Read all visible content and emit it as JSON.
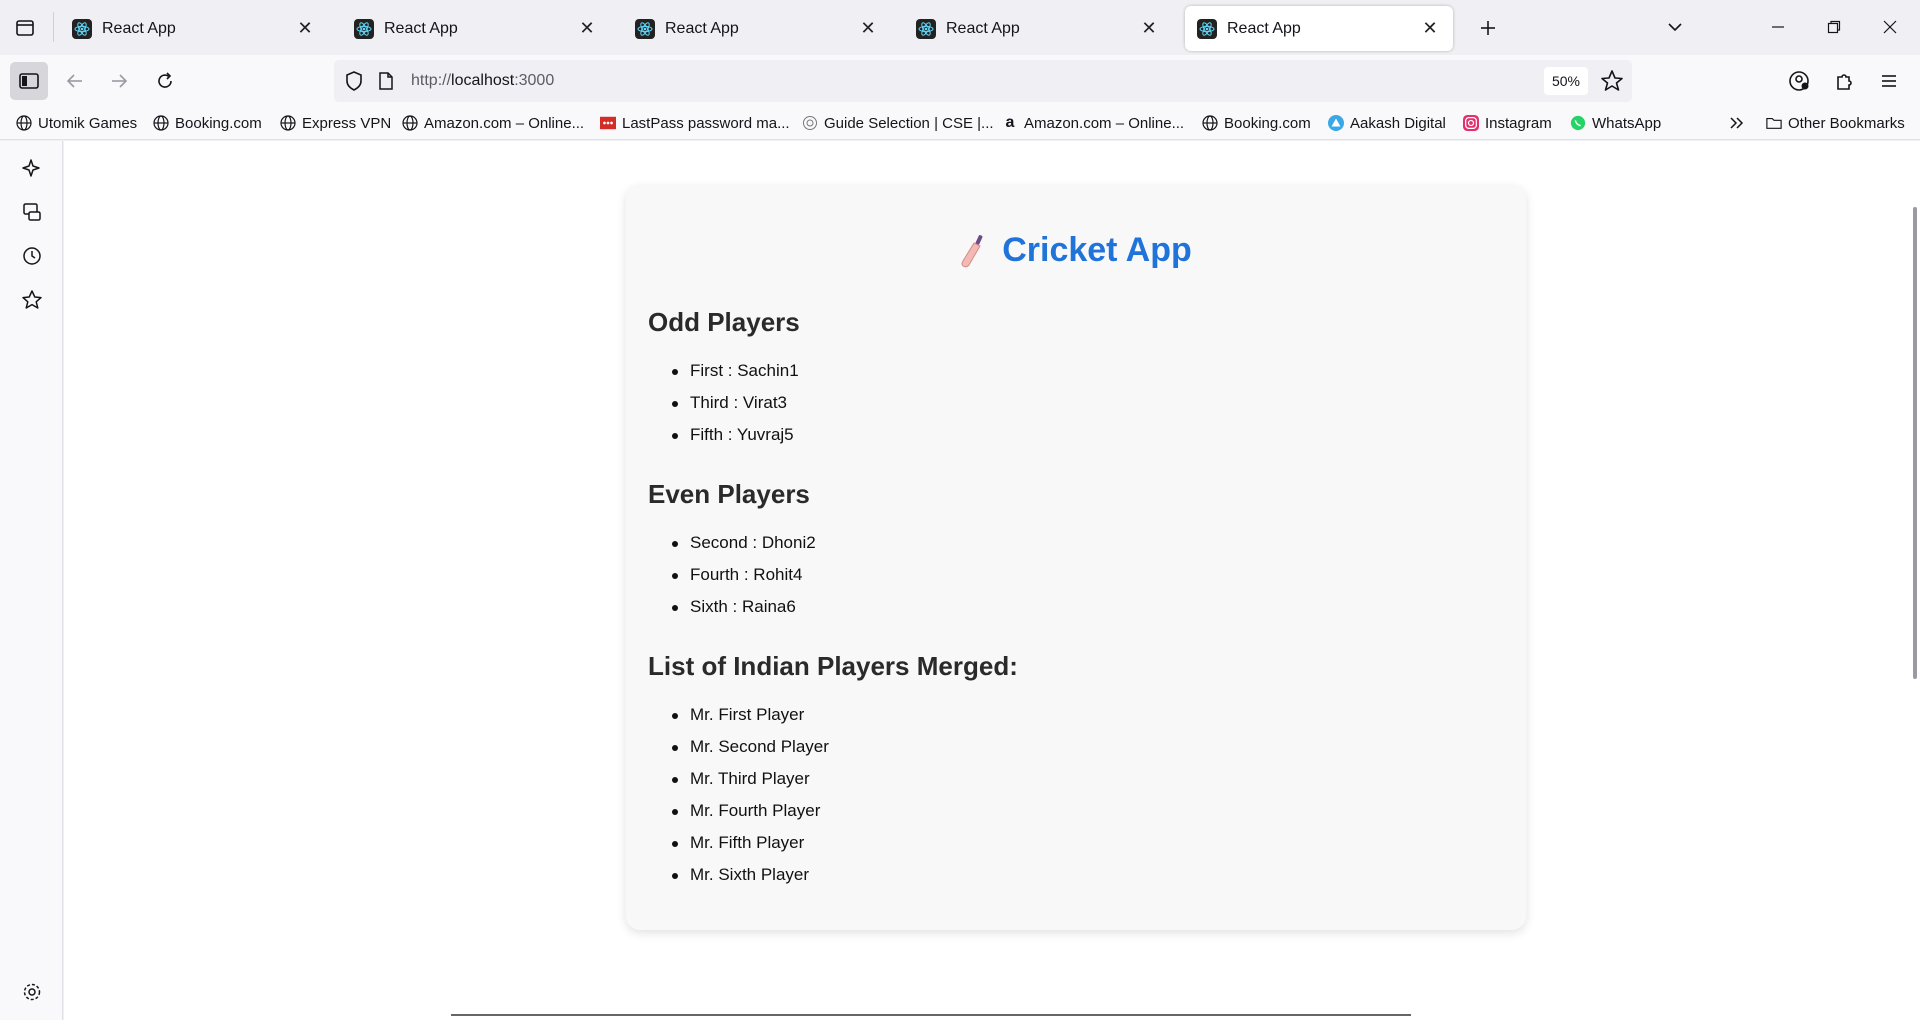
{
  "browser": {
    "tabs": [
      {
        "title": "React App",
        "active": false
      },
      {
        "title": "React App",
        "active": false
      },
      {
        "title": "React App",
        "active": false
      },
      {
        "title": "React App",
        "active": false
      },
      {
        "title": "React App",
        "active": true
      }
    ],
    "url": {
      "scheme": "http://",
      "host": "localhost",
      "port": ":3000"
    },
    "zoom": "50%",
    "bookmarks": [
      {
        "label": "Utomik Games",
        "icon": "globe-icon"
      },
      {
        "label": "Booking.com",
        "icon": "globe-icon"
      },
      {
        "label": "Express VPN",
        "icon": "globe-icon"
      },
      {
        "label": "Amazon.com – Online...",
        "icon": "globe-icon"
      },
      {
        "label": "LastPass password ma...",
        "icon": "lastpass-icon"
      },
      {
        "label": "Guide Selection | CSE |...",
        "icon": "guide-icon"
      },
      {
        "label": "Amazon.com – Online...",
        "icon": "amazon-icon"
      },
      {
        "label": "Booking.com",
        "icon": "globe-icon"
      },
      {
        "label": "Aakash Digital",
        "icon": "aakash-icon"
      },
      {
        "label": "Instagram",
        "icon": "instagram-icon"
      },
      {
        "label": "WhatsApp",
        "icon": "whatsapp-icon"
      }
    ],
    "other_bookmarks": "Other Bookmarks"
  },
  "page": {
    "title": "Cricket App",
    "odd_heading": "Odd Players",
    "odd_players": [
      "First : Sachin1",
      "Third : Virat3",
      "Fifth : Yuvraj5"
    ],
    "even_heading": "Even Players",
    "even_players": [
      "Second : Dhoni2",
      "Fourth : Rohit4",
      "Sixth : Raina6"
    ],
    "merged_heading": "List of Indian Players Merged:",
    "merged_players": [
      "Mr. First Player",
      "Mr. Second Player",
      "Mr. Third Player",
      "Mr. Fourth Player",
      "Mr. Fifth Player",
      "Mr. Sixth Player"
    ]
  },
  "colors": {
    "title_blue": "#1f73d9",
    "card_bg": "#f8f8f8"
  }
}
